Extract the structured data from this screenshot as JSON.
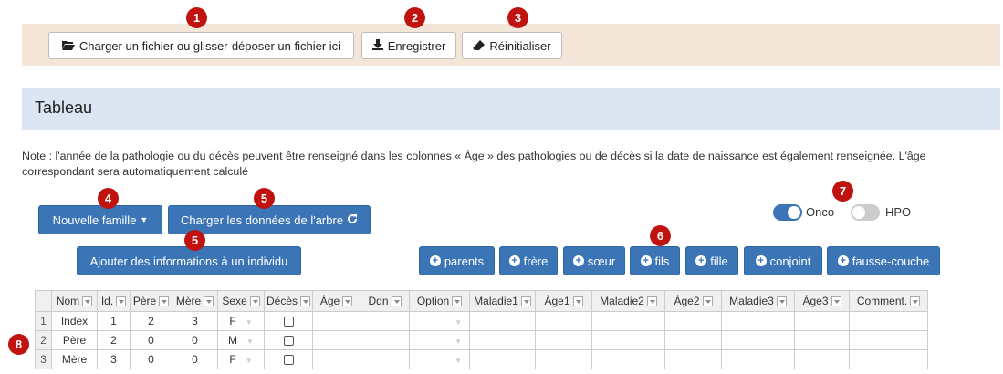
{
  "colors": {
    "primary": "#3b75b6",
    "badge": "#c0130f",
    "upload_bg": "#f3e6d8",
    "band_bg": "#dce6f2"
  },
  "toolbar": {
    "upload_label": "Charger un fichier ou glisser-déposer un fichier ici",
    "save_label": "Enregistrer",
    "reset_label": "Réinitialiser"
  },
  "section": {
    "title": "Tableau"
  },
  "note": "Note : l'année de la pathologie ou du décès peuvent être renseigné dans les colonnes « Âge » des pathologies ou de décès si la date de naissance est également renseignée. L'âge correspondant sera automatiquement calculé",
  "actions": {
    "new_family": "Nouvelle famille",
    "load_tree": "Charger les données de l'arbre",
    "add_info": "Ajouter des informations à un individu"
  },
  "add_buttons": [
    "parents",
    "frère",
    "sœur",
    "fils",
    "fille",
    "conjoint",
    "fausse-couche"
  ],
  "toggles": {
    "onco": {
      "label": "Onco",
      "on": true
    },
    "hpo": {
      "label": "HPO",
      "on": false
    }
  },
  "badges": [
    "1",
    "2",
    "3",
    "4",
    "5",
    "5",
    "6",
    "7",
    "8"
  ],
  "grid": {
    "columns": [
      "Nom",
      "Id.",
      "Père",
      "Mère",
      "Sexe",
      "Décès",
      "Âge",
      "Ddn",
      "Option",
      "Maladie1",
      "Âge1",
      "Maladie2",
      "Âge2",
      "Maladie3",
      "Âge3",
      "Comment."
    ],
    "rows": [
      {
        "n": "1",
        "nom": "Index",
        "id": "1",
        "pere": "2",
        "mere": "3",
        "sexe": "F"
      },
      {
        "n": "2",
        "nom": "Père",
        "id": "2",
        "pere": "0",
        "mere": "0",
        "sexe": "M"
      },
      {
        "n": "3",
        "nom": "Mère",
        "id": "3",
        "pere": "0",
        "mere": "0",
        "sexe": "F"
      }
    ]
  }
}
